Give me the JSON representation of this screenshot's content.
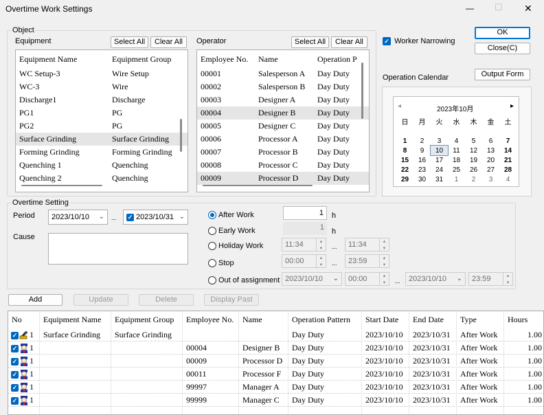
{
  "window": {
    "title": "Overtime Work Settings",
    "min": "—",
    "max": "☐",
    "close": "✕"
  },
  "object": {
    "title": "Object",
    "equipment": {
      "label": "Equipment",
      "select_all": "Select All",
      "clear_all": "Clear All",
      "headers": [
        "Equipment Name",
        "Equipment Group"
      ],
      "rows": [
        [
          "WC Setup-3",
          "Wire Setup"
        ],
        [
          "WC-3",
          "Wire"
        ],
        [
          "Discharge1",
          "Discharge"
        ],
        [
          "PG1",
          "PG"
        ],
        [
          "PG2",
          "PG"
        ],
        [
          "Surface Grinding",
          "Surface Grinding"
        ],
        [
          "Forming Grinding",
          "Forming Grinding"
        ],
        [
          "Quenching 1",
          "Quenching"
        ],
        [
          "Quenching 2",
          "Quenching"
        ]
      ]
    },
    "operator": {
      "label": "Operator",
      "select_all": "Select All",
      "clear_all": "Clear All",
      "headers": [
        "Employee No.",
        "Name",
        "Operation P"
      ],
      "rows": [
        [
          "00001",
          "Salesperson A",
          "Day Duty"
        ],
        [
          "00002",
          "Salesperson B",
          "Day Duty"
        ],
        [
          "00003",
          "Designer A",
          "Day Duty"
        ],
        [
          "00004",
          "Designer B",
          "Day Duty"
        ],
        [
          "00005",
          "Designer C",
          "Day Duty"
        ],
        [
          "00006",
          "Processor A",
          "Day Duty"
        ],
        [
          "00007",
          "Processor B",
          "Day Duty"
        ],
        [
          "00008",
          "Processor C",
          "Day Duty"
        ],
        [
          "00009",
          "Processor D",
          "Day Duty"
        ]
      ]
    }
  },
  "worker_narrowing": {
    "label": "Worker Narrowing",
    "checked": true
  },
  "buttons": {
    "ok": "OK",
    "close": "Close(C)",
    "output_form": "Output Form",
    "add": "Add",
    "update": "Update",
    "delete": "Delete",
    "display_past": "Display Past"
  },
  "calendar": {
    "label": "Operation Calendar",
    "month": "2023年10月",
    "prev": "◂",
    "next": "▸",
    "weekdays": [
      "日",
      "月",
      "火",
      "水",
      "木",
      "金",
      "土"
    ],
    "weeks": [
      [
        "",
        "",
        "",
        "",
        "",
        "",
        ""
      ],
      [
        "1",
        "2",
        "3",
        "4",
        "5",
        "6",
        "7"
      ],
      [
        "8",
        "9",
        "10",
        "11",
        "12",
        "13",
        "14"
      ],
      [
        "15",
        "16",
        "17",
        "18",
        "19",
        "20",
        "21"
      ],
      [
        "22",
        "23",
        "24",
        "25",
        "26",
        "27",
        "28"
      ],
      [
        "29",
        "30",
        "31",
        "1",
        "2",
        "3",
        "4"
      ]
    ],
    "selected": "10"
  },
  "overtime": {
    "title": "Overtime Setting",
    "period_label": "Period",
    "period_from": "2023/10/10",
    "period_to": "2023/10/31",
    "period_sep": "...",
    "cause_label": "Cause",
    "after_work": {
      "label": "After Work",
      "value": "1",
      "unit": "h"
    },
    "early_work": {
      "label": "Early Work",
      "value": "1",
      "unit": "h"
    },
    "holiday_work": {
      "label": "Holiday Work",
      "from": "11:34",
      "to": "11:34",
      "sep": "..."
    },
    "stop": {
      "label": "Stop",
      "from": "00:00",
      "to": "23:59",
      "sep": "..."
    },
    "out_of_assignment": {
      "label": "Out of assignment",
      "date_from": "2023/10/10",
      "time_from": "00:00",
      "date_to": "2023/10/10",
      "time_to": "23:59",
      "sep": "..."
    }
  },
  "table": {
    "headers": [
      "No",
      "Equipment Name",
      "Equipment Group",
      "Employee No.",
      "Name",
      "Operation Pattern",
      "Start Date",
      "End Date",
      "Type",
      "Hours"
    ],
    "rows": [
      {
        "no": "1",
        "eq": "Surface Grinding",
        "grp": "Surface Grinding",
        "emp": "",
        "name": "",
        "pat": "Day Duty",
        "start": "2023/10/10",
        "end": "2023/10/31",
        "type": "After Work",
        "hours": "1.00",
        "icon": "equipment"
      },
      {
        "no": "1",
        "eq": "",
        "grp": "",
        "emp": "00004",
        "name": "Designer B",
        "pat": "Day Duty",
        "start": "2023/10/10",
        "end": "2023/10/31",
        "type": "After Work",
        "hours": "1.00",
        "icon": "worker"
      },
      {
        "no": "1",
        "eq": "",
        "grp": "",
        "emp": "00009",
        "name": "Processor D",
        "pat": "Day Duty",
        "start": "2023/10/10",
        "end": "2023/10/31",
        "type": "After Work",
        "hours": "1.00",
        "icon": "worker"
      },
      {
        "no": "1",
        "eq": "",
        "grp": "",
        "emp": "00011",
        "name": "Processor F",
        "pat": "Day Duty",
        "start": "2023/10/10",
        "end": "2023/10/31",
        "type": "After Work",
        "hours": "1.00",
        "icon": "worker"
      },
      {
        "no": "1",
        "eq": "",
        "grp": "",
        "emp": "99997",
        "name": "Manager A",
        "pat": "Day Duty",
        "start": "2023/10/10",
        "end": "2023/10/31",
        "type": "After Work",
        "hours": "1.00",
        "icon": "worker"
      },
      {
        "no": "1",
        "eq": "",
        "grp": "",
        "emp": "99999",
        "name": "Manager C",
        "pat": "Day Duty",
        "start": "2023/10/10",
        "end": "2023/10/31",
        "type": "After Work",
        "hours": "1.00",
        "icon": "worker"
      }
    ]
  }
}
